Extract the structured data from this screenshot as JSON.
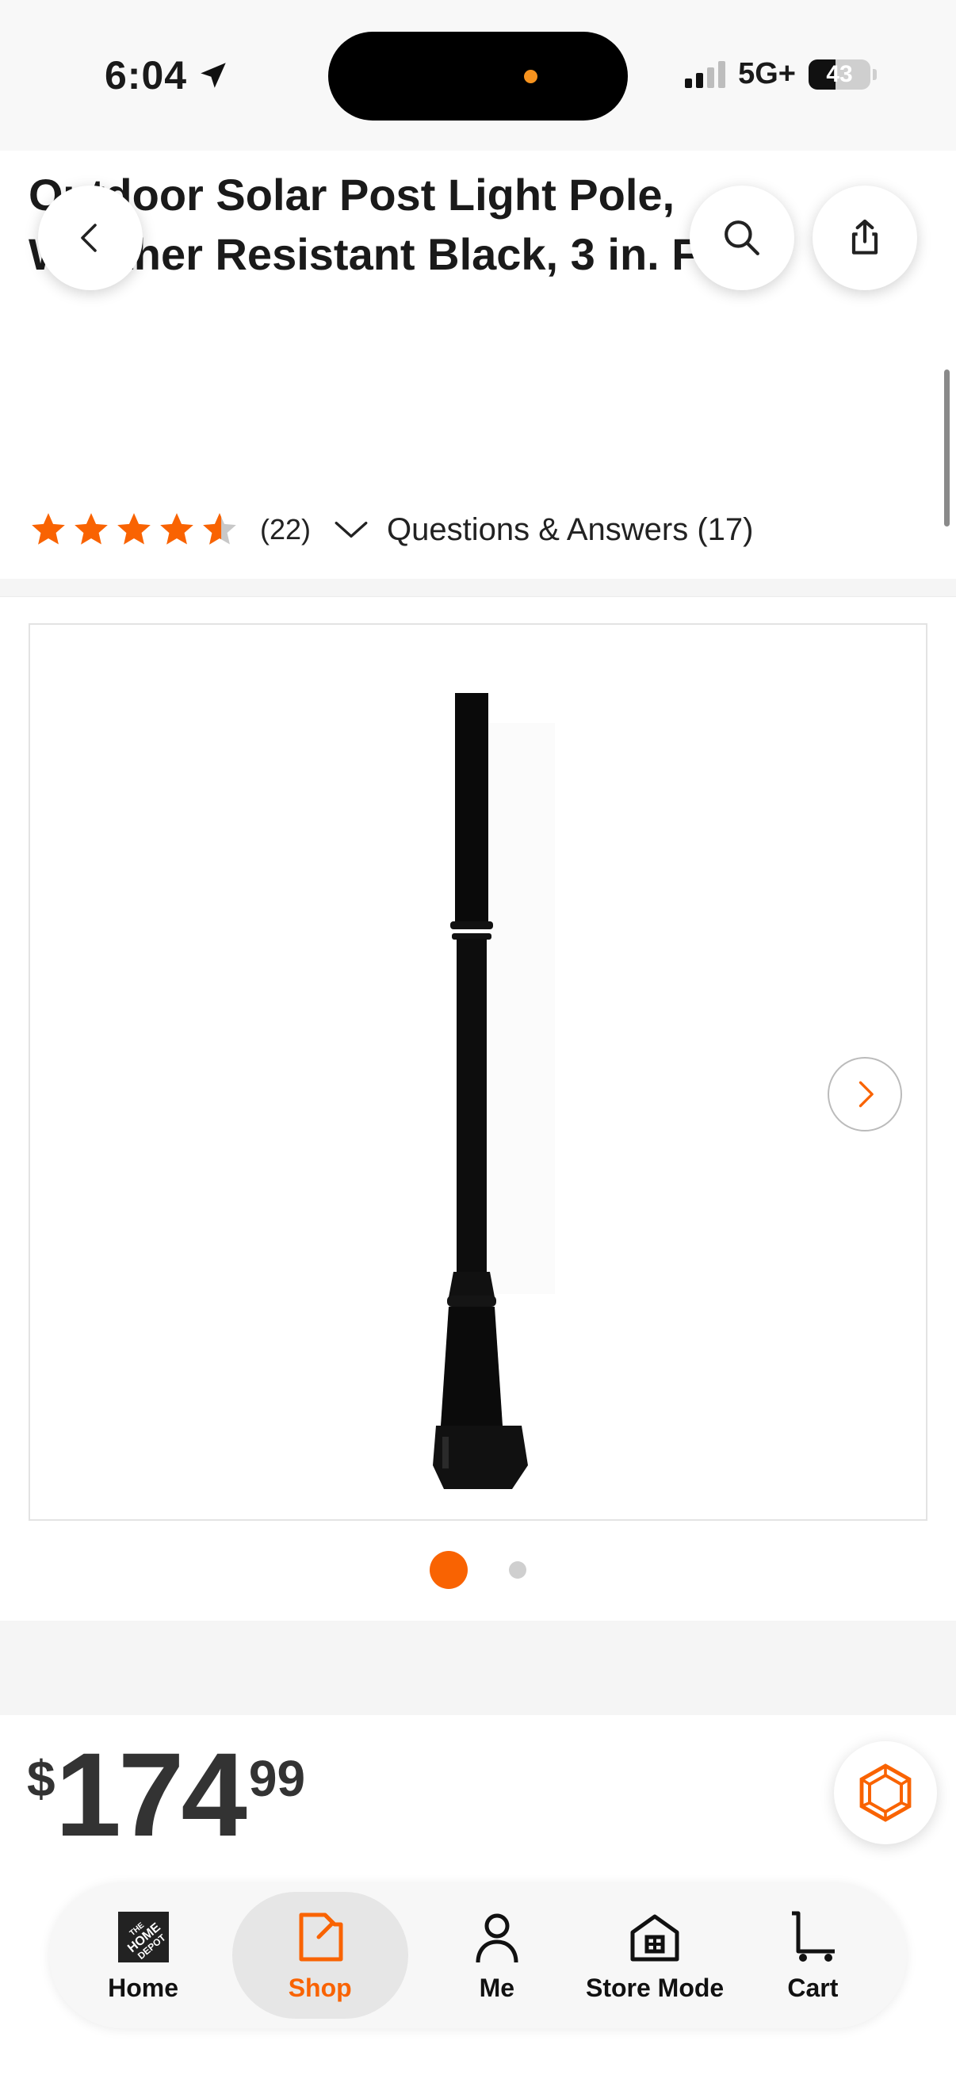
{
  "status_bar": {
    "time": "6:04",
    "network": "5G+",
    "battery": "43"
  },
  "product": {
    "title": "Outdoor Solar Post Light Pole, Weather Resistant Black, 3 in. Fitter",
    "rating": 4.5,
    "review_count": "(22)",
    "qa_label": "Questions & Answers (17)"
  },
  "gallery": {
    "image_count": 2,
    "current_index": 1
  },
  "price": {
    "currency": "$",
    "dollars": "174",
    "cents": "99"
  },
  "tabbar": {
    "home": "Home",
    "shop": "Shop",
    "me": "Me",
    "store_mode": "Store Mode",
    "cart": "Cart"
  },
  "colors": {
    "brand": "#f96302",
    "star": "#f96302"
  }
}
